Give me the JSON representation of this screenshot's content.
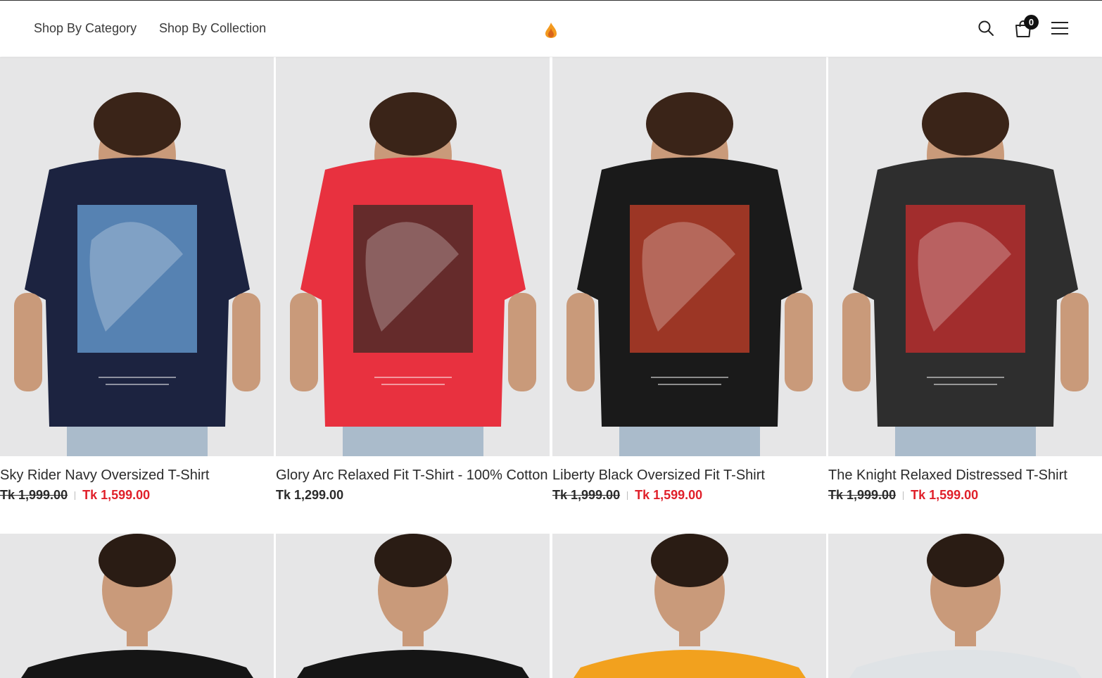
{
  "header": {
    "nav": [
      "Shop By Category",
      "Shop By Collection"
    ],
    "cart_count": "0",
    "icons": {
      "logo": "flame-logo",
      "search": "search-icon",
      "cart": "shopping-bag-icon",
      "menu": "hamburger-menu-icon"
    }
  },
  "products": [
    {
      "title": "Sky Rider Navy Oversized T-Shirt",
      "old_price": "Tk 1,999.00",
      "price": "Tk 1,599.00",
      "shirt_color": "#1c2340",
      "print_color": "#6aa3d8"
    },
    {
      "title": "Glory Arc Relaxed Fit T-Shirt - 100% Cotton",
      "price": "Tk 1,299.00",
      "shirt_color": "#e8313f",
      "print_color": "#3a2a26"
    },
    {
      "title": "Liberty Black Oversized Fit T-Shirt",
      "old_price": "Tk 1,999.00",
      "price": "Tk 1,599.00",
      "shirt_color": "#1a1a1a",
      "print_color": "#c8402a"
    },
    {
      "title": "The Knight Relaxed Distressed T-Shirt",
      "old_price": "Tk 1,999.00",
      "price": "Tk 1,599.00",
      "shirt_color": "#2e2e2e",
      "print_color": "#c92d2d"
    }
  ],
  "products_row2": [
    {
      "shirt_color": "#151515"
    },
    {
      "shirt_color": "#151515"
    },
    {
      "shirt_color": "#f2a11e"
    },
    {
      "shirt_color": "#dfe3e6"
    }
  ],
  "colors": {
    "accent_sale": "#e0202a",
    "logo_orange": "#f39a1f"
  }
}
